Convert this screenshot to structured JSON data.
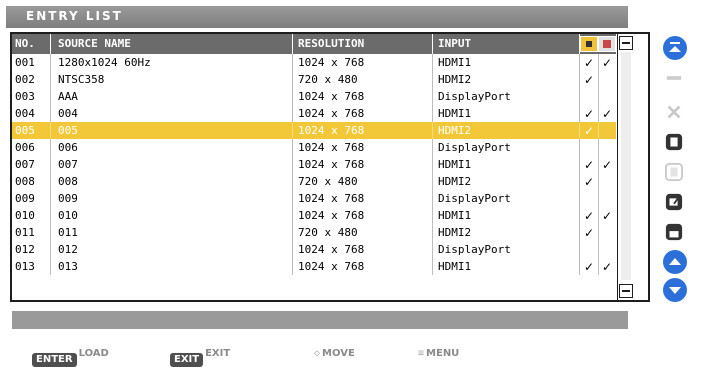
{
  "window": {
    "title": "ENTRY LIST"
  },
  "table": {
    "columns": {
      "no": "NO.",
      "source_name": "SOURCE NAME",
      "resolution": "RESOLUTION",
      "input": "INPUT"
    },
    "rows": [
      {
        "no": "001",
        "name": "1280x1024 60Hz",
        "resolution": "1024 x 768",
        "input": "HDMI1",
        "lock": "✓",
        "skip": "✓"
      },
      {
        "no": "002",
        "name": "NTSC358",
        "resolution": "720 x 480",
        "input": "HDMI2",
        "lock": "✓",
        "skip": ""
      },
      {
        "no": "003",
        "name": "AAA",
        "resolution": "1024 x 768",
        "input": "DisplayPort",
        "lock": "",
        "skip": ""
      },
      {
        "no": "004",
        "name": "004",
        "resolution": "1024 x 768",
        "input": "HDMI1",
        "lock": "✓",
        "skip": "✓"
      },
      {
        "no": "005",
        "name": "005",
        "resolution": "1024 x 768",
        "input": "HDMI2",
        "lock": "✓",
        "skip": "",
        "selected": true
      },
      {
        "no": "006",
        "name": "006",
        "resolution": "1024 x 768",
        "input": "DisplayPort",
        "lock": "",
        "skip": ""
      },
      {
        "no": "007",
        "name": "007",
        "resolution": "1024 x 768",
        "input": "HDMI1",
        "lock": "✓",
        "skip": "✓"
      },
      {
        "no": "008",
        "name": "008",
        "resolution": "720 x 480",
        "input": "HDMI2",
        "lock": "✓",
        "skip": ""
      },
      {
        "no": "009",
        "name": "009",
        "resolution": "1024 x 768",
        "input": "DisplayPort",
        "lock": "",
        "skip": ""
      },
      {
        "no": "010",
        "name": "010",
        "resolution": "1024 x 768",
        "input": "HDMI1",
        "lock": "✓",
        "skip": "✓"
      },
      {
        "no": "011",
        "name": "011",
        "resolution": "720 x 480",
        "input": "HDMI2",
        "lock": "✓",
        "skip": ""
      },
      {
        "no": "012",
        "name": "012",
        "resolution": "1024 x 768",
        "input": "DisplayPort",
        "lock": "",
        "skip": ""
      },
      {
        "no": "013",
        "name": "013",
        "resolution": "1024 x 768",
        "input": "HDMI1",
        "lock": "✓",
        "skip": "✓"
      }
    ]
  },
  "status_message": "",
  "footer": {
    "load_key": "ENTER",
    "load_label": "LOAD",
    "exit_key": "EXIT",
    "exit_label": "EXIT",
    "move_label": "MOVE",
    "menu_label": "MENU"
  },
  "icons": {
    "header_lock": "lock-icon",
    "header_skip": "skip-icon",
    "side": [
      "scroll-top-icon",
      "cut-icon",
      "delete-icon",
      "copy-icon",
      "paste-icon",
      "edit-icon",
      "save-icon",
      "page-up-icon",
      "page-down-icon"
    ]
  },
  "colors": {
    "selected_row": "#f2c838",
    "header_bg": "#6b6b6b",
    "accent_blue": "#2d6fd8"
  }
}
